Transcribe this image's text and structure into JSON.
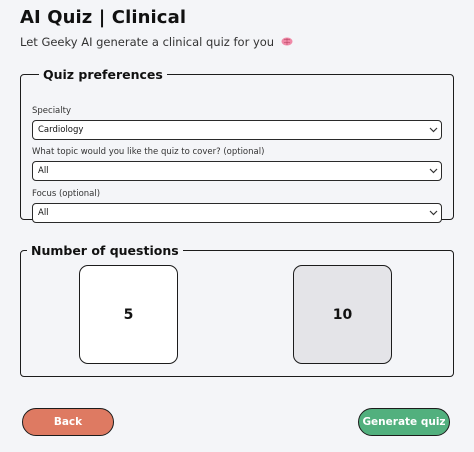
{
  "header": {
    "title": "AI Quiz | Clinical",
    "subtitle": "Let Geeky AI generate a clinical quiz for you",
    "subtitle_icon": "brain-icon"
  },
  "preferences": {
    "legend": "Quiz preferences",
    "specialty": {
      "label": "Specialty",
      "value": "Cardiology"
    },
    "topic": {
      "label": "What topic would you like the quiz to cover? (optional)",
      "value": "All"
    },
    "focus": {
      "label": "Focus (optional)",
      "value": "All"
    }
  },
  "questions": {
    "legend": "Number of questions",
    "options": [
      {
        "label": "5",
        "selected": false
      },
      {
        "label": "10",
        "selected": true
      }
    ]
  },
  "actions": {
    "back_label": "Back",
    "generate_label": "Generate quiz"
  },
  "colors": {
    "back": "#de7a62",
    "generate": "#52b07e",
    "selected_option": "#e4e4e8",
    "background": "#f4f5f8"
  }
}
